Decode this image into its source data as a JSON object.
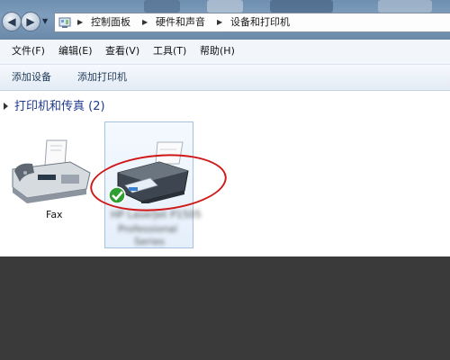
{
  "address_bar": {
    "crumbs": [
      "控制面板",
      "硬件和声音",
      "设备和打印机"
    ]
  },
  "menu": {
    "items": [
      "文件(F)",
      "编辑(E)",
      "查看(V)",
      "工具(T)",
      "帮助(H)"
    ]
  },
  "commands": {
    "add_device": "添加设备",
    "add_printer": "添加打印机"
  },
  "group": {
    "title": "打印机和传真 (2)"
  },
  "devices": [
    {
      "label": "Fax",
      "icon": "fax-icon"
    },
    {
      "label_line1": "HP LaserJet P1505",
      "label_line2": "Professional",
      "label_line3": "Series",
      "icon": "printer-icon",
      "is_default": true
    }
  ],
  "colors": {
    "group_title": "#1e3a8c",
    "highlight": "#d01818",
    "selection_border": "#a6c2e0"
  }
}
